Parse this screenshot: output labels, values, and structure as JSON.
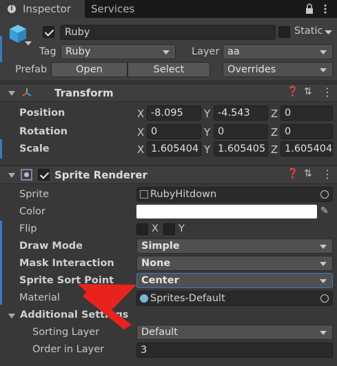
{
  "tabs": [
    {
      "label": "Inspector",
      "active": true
    },
    {
      "label": "Services",
      "active": false
    }
  ],
  "header": {
    "name": "Ruby",
    "static_label": "Static",
    "tag_label": "Tag",
    "tag_value": "Ruby",
    "layer_label": "Layer",
    "layer_value": "aa",
    "prefab_label": "Prefab",
    "open_label": "Open",
    "select_label": "Select",
    "overrides_label": "Overrides"
  },
  "transform": {
    "title": "Transform",
    "rows": [
      {
        "label": "Position",
        "x": "-8.095",
        "y": "-4.543",
        "z": "0"
      },
      {
        "label": "Rotation",
        "x": "0",
        "y": "0",
        "z": "0"
      },
      {
        "label": "Scale",
        "x": "1.605404",
        "y": "1.605405",
        "z": "1.605404"
      }
    ],
    "axis": {
      "x": "X",
      "y": "Y",
      "z": "Z"
    }
  },
  "sprite_renderer": {
    "title": "Sprite Renderer",
    "sprite_label": "Sprite",
    "sprite_value": "RubyHitdown",
    "color_label": "Color",
    "flip_label": "Flip",
    "flip_x": "X",
    "flip_y": "Y",
    "draw_mode_label": "Draw Mode",
    "draw_mode_value": "Simple",
    "mask_label": "Mask Interaction",
    "mask_value": "None",
    "sort_point_label": "Sprite Sort Point",
    "sort_point_value": "Center",
    "material_label": "Material",
    "material_value": "Sprites-Default",
    "additional_label": "Additional Settings",
    "sorting_layer_label": "Sorting Layer",
    "sorting_layer_value": "Default",
    "order_label": "Order in Layer",
    "order_value": "3"
  },
  "colors": {
    "accent": "#3a78c2",
    "annotation_arrow": "#e8231e",
    "selected_label": "#6ea3e6"
  }
}
